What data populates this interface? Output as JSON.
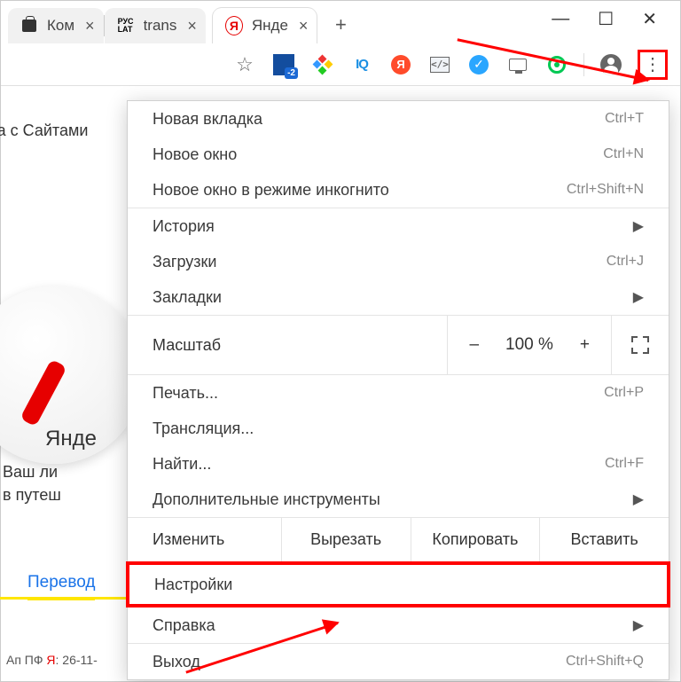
{
  "window": {
    "min": "—",
    "max": "☐",
    "close": "✕"
  },
  "tabs": {
    "t0": {
      "title": "Ком"
    },
    "t1": {
      "title": "trans"
    },
    "t2": {
      "title": "Янде",
      "ya": "Я"
    },
    "plus": "+"
  },
  "toolbar": {
    "iq": "IQ",
    "ya": "Я",
    "code": "</>",
    "check": "✓"
  },
  "page": {
    "hint1": "ота с Сайтами",
    "hint2": "Янде",
    "hint3a": "Ваш ли",
    "hint3b": "в путеш",
    "link": "Перевод",
    "footer_a": "Ап ПФ ",
    "footer_b": "Я",
    "footer_c": ": 26-11-"
  },
  "menu": {
    "new_tab": {
      "label": "Новая вкладка",
      "sc": "Ctrl+T"
    },
    "new_win": {
      "label": "Новое окно",
      "sc": "Ctrl+N"
    },
    "incog": {
      "label": "Новое окно в режиме инкогнито",
      "sc": "Ctrl+Shift+N"
    },
    "history": {
      "label": "История"
    },
    "downloads": {
      "label": "Загрузки",
      "sc": "Ctrl+J"
    },
    "bookmarks": {
      "label": "Закладки"
    },
    "zoom": {
      "label": "Масштаб",
      "minus": "–",
      "value": "100 %",
      "plus": "+"
    },
    "print": {
      "label": "Печать...",
      "sc": "Ctrl+P"
    },
    "cast": {
      "label": "Трансляция..."
    },
    "find": {
      "label": "Найти...",
      "sc": "Ctrl+F"
    },
    "more": {
      "label": "Дополнительные инструменты"
    },
    "edit": {
      "label": "Изменить",
      "cut": "Вырезать",
      "copy": "Копировать",
      "paste": "Вставить"
    },
    "settings": {
      "label": "Настройки"
    },
    "help": {
      "label": "Справка"
    },
    "exit": {
      "label": "Выход",
      "sc": "Ctrl+Shift+Q"
    }
  }
}
